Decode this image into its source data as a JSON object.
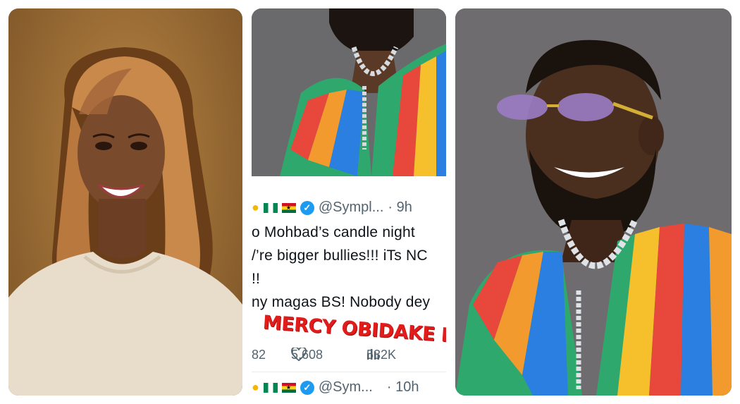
{
  "images": {
    "left": {
      "name": "portrait-woman"
    },
    "right": {
      "name": "portrait-man-sunglasses"
    }
  },
  "tweet1": {
    "handle": "@Sympl...",
    "time": "· 9h",
    "lines": [
      "o Mohbad’s candle night",
      "/’re bigger bullies!!! iTs NC",
      "!!",
      "ny magas BS! Nobody dey"
    ],
    "overlay": "MERCY OBIDAKE BL",
    "stats": {
      "replies": "82",
      "likes": "5,608",
      "views": "532K"
    }
  },
  "tweet2": {
    "handle": "@Sym...",
    "time": "· 10h"
  },
  "colors": {
    "verified": "#1d9bf0",
    "overlay": "#e21b1b",
    "text": "#0f1419",
    "muted": "#536471"
  },
  "icons": [
    "verified-badge-icon",
    "flag-nigeria-icon",
    "flag-ghana-icon",
    "heart-icon",
    "views-bars-icon"
  ]
}
